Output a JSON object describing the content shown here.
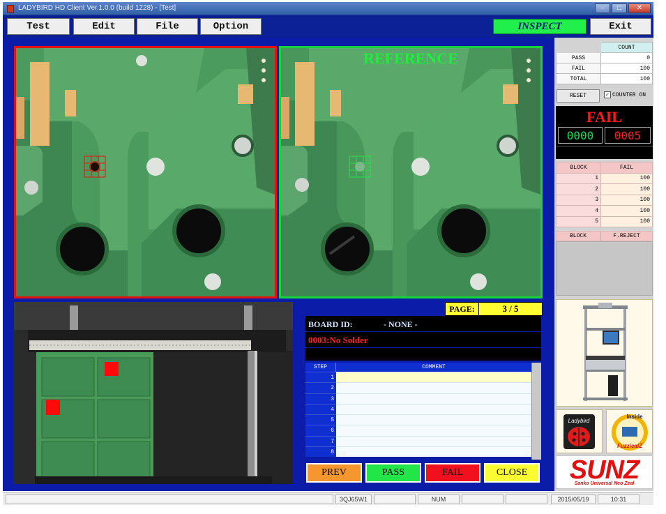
{
  "window": {
    "title": "LADYBIRD HD Client Ver.1.0.0  (build 1228) - [Test]",
    "controls": [
      "minimize",
      "maximize",
      "close"
    ]
  },
  "menu": {
    "items": [
      "Test",
      "Edit",
      "File",
      "Option"
    ],
    "mode": "INSPECT",
    "exit_label": "Exit"
  },
  "views": {
    "reference_label": "REFERENCE"
  },
  "inspection": {
    "page_label": "PAGE:",
    "page_value": "3 / 5",
    "board_id_label": "BOARD ID:",
    "board_id_value": "- NONE -",
    "defect": "0003:No  Solder",
    "step_header": "STEP",
    "comment_header": "COMMENT",
    "steps": [
      "1",
      "2",
      "3",
      "4",
      "5",
      "6",
      "7",
      "8"
    ],
    "selected_step": "1",
    "buttons": [
      {
        "label": "PREV",
        "color": "#f5962e"
      },
      {
        "label": "PASS",
        "color": "#22e648"
      },
      {
        "label": "FAIL",
        "color": "#f0101e"
      },
      {
        "label": "CLOSE",
        "color": "#fbfb34"
      }
    ]
  },
  "counts": {
    "header": "COUNT",
    "rows": [
      {
        "key": "PASS",
        "value": "0"
      },
      {
        "key": "FAIL",
        "value": "100"
      },
      {
        "key": "TOTAL",
        "value": "100"
      }
    ],
    "reset_label": "RESET",
    "counter_on_label": "COUNTER ON",
    "counter_on_checked": true
  },
  "result": {
    "status": "FAIL",
    "counter_left": "0000",
    "counter_right": "0005"
  },
  "blocks": {
    "header_block": "BLOCK",
    "header_fail": "FAIL",
    "rows": [
      {
        "block": "1",
        "fail": "100"
      },
      {
        "block": "2",
        "fail": "100"
      },
      {
        "block": "3",
        "fail": "100"
      },
      {
        "block": "4",
        "fail": "100"
      },
      {
        "block": "5",
        "fail": "100"
      }
    ],
    "reject_header_block": "BLOCK",
    "reject_header_freject": "F.REJECT"
  },
  "logos": {
    "ladybird": "Ladybird",
    "inside": "Inside",
    "fuzzicalz": "FuzzicalZ",
    "sunz": "SUNZ",
    "sunz_tagline": "Sanko Universal Neo Zeal"
  },
  "statusbar": {
    "code": "3QJ65W1",
    "num": "NUM",
    "date": "2015/05/19",
    "time": "10:31"
  },
  "colors": {
    "main_blue": "#0a1ca8",
    "inspect_green": "#21f04c",
    "fail_red": "#ff1a1a"
  }
}
